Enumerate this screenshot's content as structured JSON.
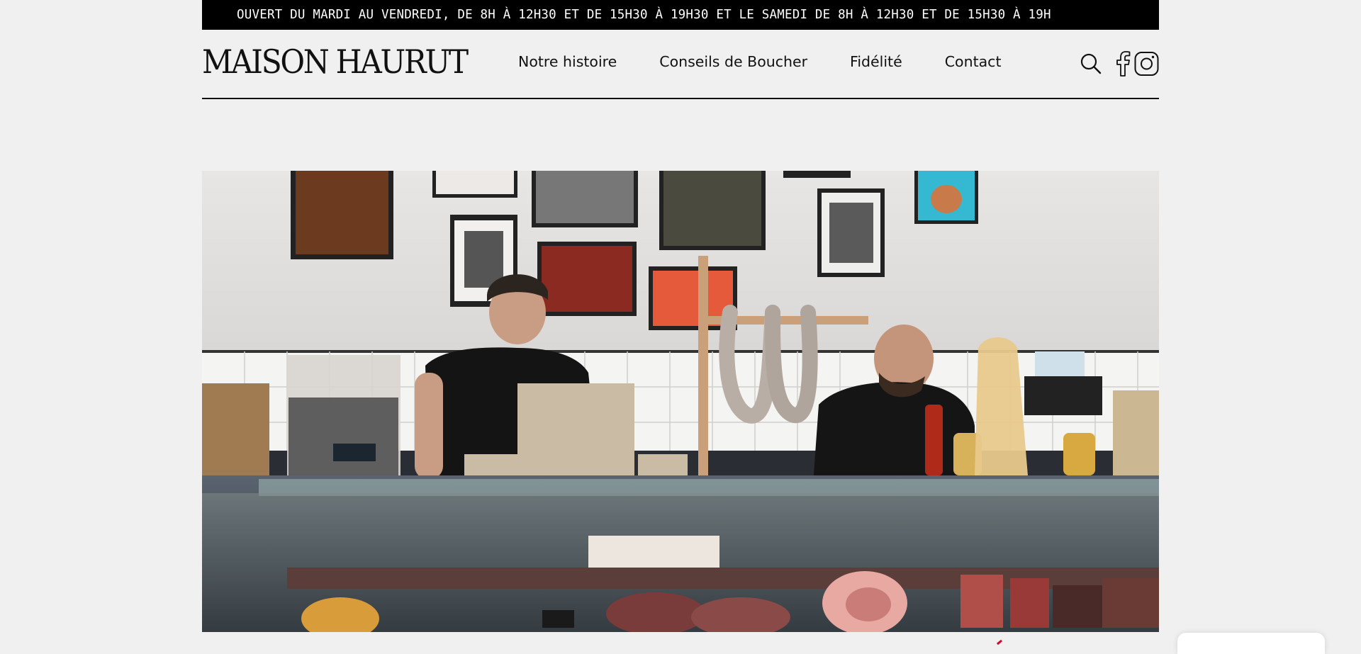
{
  "announcement": {
    "text": "OUVERT DU MARDI AU VENDREDI, DE 8H À 12H30 ET DE 15H30 À 19H30 ET LE SAMEDI DE 8H À 12H30 ET DE 15H30 À 19H"
  },
  "header": {
    "logo": "MAISON HAURUT",
    "nav": [
      {
        "label": "Notre histoire"
      },
      {
        "label": "Conseils de Boucher"
      },
      {
        "label": "Fidélité"
      },
      {
        "label": "Contact"
      }
    ],
    "icons": [
      "search-icon",
      "facebook-icon",
      "instagram-icon"
    ]
  },
  "hero": {
    "image": "butcher-shop-photo"
  },
  "colors": {
    "background": "#f0f0f0",
    "bar": "#000000",
    "text": "#111111",
    "accent": "#c8102e"
  }
}
